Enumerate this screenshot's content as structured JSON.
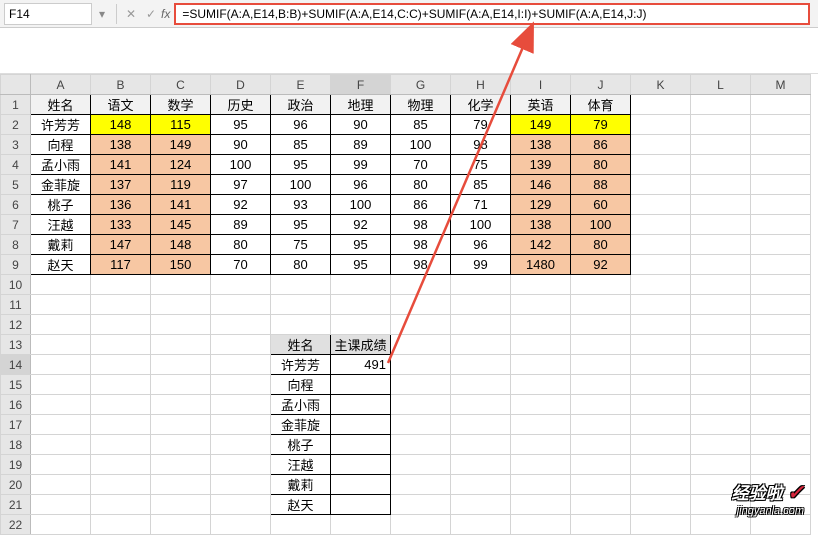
{
  "formula_bar": {
    "name_box": "F14",
    "cancel": "✕",
    "confirm": "✓",
    "fx": "fx",
    "formula": "=SUMIF(A:A,E14,B:B)+SUMIF(A:A,E14,C:C)+SUMIF(A:A,E14,I:I)+SUMIF(A:A,E14,J:J)"
  },
  "columns": [
    "A",
    "B",
    "C",
    "D",
    "E",
    "F",
    "G",
    "H",
    "I",
    "J",
    "K",
    "L",
    "M"
  ],
  "rows": [
    "1",
    "2",
    "3",
    "4",
    "5",
    "6",
    "7",
    "8",
    "9",
    "10",
    "11",
    "12",
    "13",
    "14",
    "15",
    "16",
    "17",
    "18",
    "19",
    "20",
    "21",
    "22"
  ],
  "headers": {
    "A": "姓名",
    "B": "语文",
    "C": "数学",
    "D": "历史",
    "E": "政治",
    "F": "地理",
    "G": "物理",
    "H": "化学",
    "I": "英语",
    "J": "体育"
  },
  "table": [
    {
      "name": "许芳芳",
      "B": "148",
      "C": "115",
      "D": "95",
      "E": "96",
      "F": "90",
      "G": "85",
      "H": "79",
      "I": "149",
      "J": "79",
      "hl": true
    },
    {
      "name": "向程",
      "B": "138",
      "C": "149",
      "D": "90",
      "E": "85",
      "F": "89",
      "G": "100",
      "H": "98",
      "I": "138",
      "J": "86"
    },
    {
      "name": "孟小雨",
      "B": "141",
      "C": "124",
      "D": "100",
      "E": "95",
      "F": "99",
      "G": "70",
      "H": "75",
      "I": "139",
      "J": "80"
    },
    {
      "name": "金菲旋",
      "B": "137",
      "C": "119",
      "D": "97",
      "E": "100",
      "F": "96",
      "G": "80",
      "H": "85",
      "I": "146",
      "J": "88"
    },
    {
      "name": "桃子",
      "B": "136",
      "C": "141",
      "D": "92",
      "E": "93",
      "F": "100",
      "G": "86",
      "H": "71",
      "I": "129",
      "J": "60"
    },
    {
      "name": "汪越",
      "B": "133",
      "C": "145",
      "D": "89",
      "E": "95",
      "F": "92",
      "G": "98",
      "H": "100",
      "I": "138",
      "J": "100"
    },
    {
      "name": "戴莉",
      "B": "147",
      "C": "148",
      "D": "80",
      "E": "75",
      "F": "95",
      "G": "98",
      "H": "96",
      "I": "142",
      "J": "80"
    },
    {
      "name": "赵天",
      "B": "117",
      "C": "150",
      "D": "70",
      "E": "80",
      "F": "95",
      "G": "98",
      "H": "99",
      "I": "1480",
      "J": "92"
    }
  ],
  "lookup": {
    "hdr_name": "姓名",
    "hdr_score": "主课成绩",
    "rows": [
      {
        "name": "许芳芳",
        "score": "491"
      },
      {
        "name": "向程",
        "score": ""
      },
      {
        "name": "孟小雨",
        "score": ""
      },
      {
        "name": "金菲旋",
        "score": ""
      },
      {
        "name": "桃子",
        "score": ""
      },
      {
        "name": "汪越",
        "score": ""
      },
      {
        "name": "戴莉",
        "score": ""
      },
      {
        "name": "赵天",
        "score": ""
      }
    ]
  },
  "watermark": {
    "title": "经验啦",
    "check": "✓",
    "url": "jingyanla.com"
  }
}
